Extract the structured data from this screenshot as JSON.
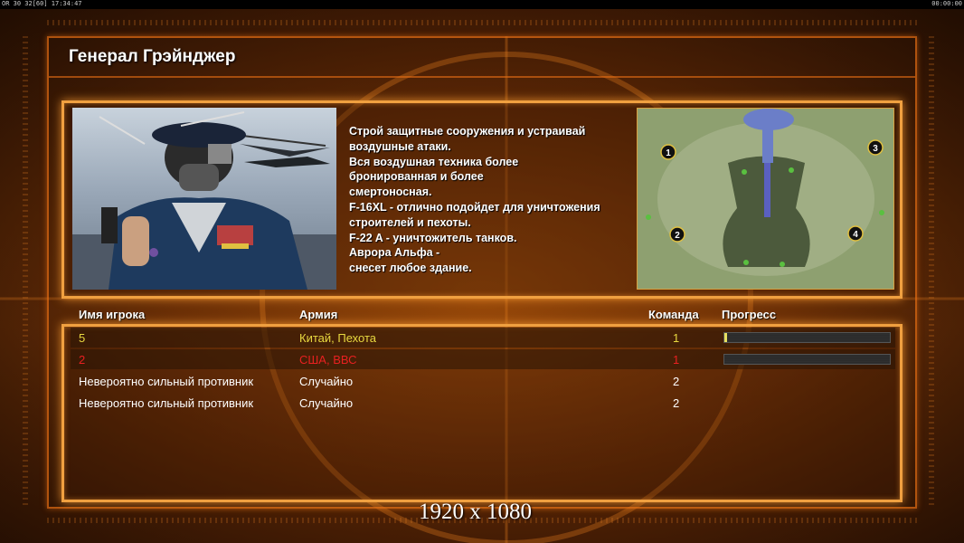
{
  "status_bar": {
    "left_text": "ОR 30 32[60] 17:34:47",
    "right_text": "00:00:00"
  },
  "general": {
    "title": "Генерал Грэйнджер",
    "description": "Строй защитные сооружения и устраивай\n воздушные атаки.\nВся воздушная техника более\n бронированная и более\nсмертоносная.\nF-16XL - отлично подойдет для уничтожения\n строителей и пехоты.\nF-22 A - уничтожитель танков.\nАврора Альфа -\nснесет любое здание."
  },
  "minimap": {
    "start_markers": [
      "1",
      "2",
      "3",
      "4"
    ]
  },
  "table": {
    "headers": {
      "player": "Имя игрока",
      "army": "Армия",
      "team": "Команда",
      "progress": "Прогресс"
    },
    "rows": [
      {
        "player": "5",
        "army": "Китай, Пехота",
        "team": "1",
        "progress": 0.01,
        "color": "#e8d840"
      },
      {
        "player": "2",
        "army": "США, ВВС",
        "team": "1",
        "progress": 0.0,
        "color": "#e82020"
      },
      {
        "player": "Невероятно сильный противник",
        "army": "Случайно",
        "team": "2",
        "color": "#ffffff"
      },
      {
        "player": "Невероятно сильный противник",
        "army": "Случайно",
        "team": "2",
        "color": "#ffffff"
      }
    ]
  },
  "resolution_label": "1920 x 1080",
  "colors": {
    "frame_accent": "#f0a040",
    "player_yellow": "#e8d840",
    "player_red": "#e82020"
  }
}
